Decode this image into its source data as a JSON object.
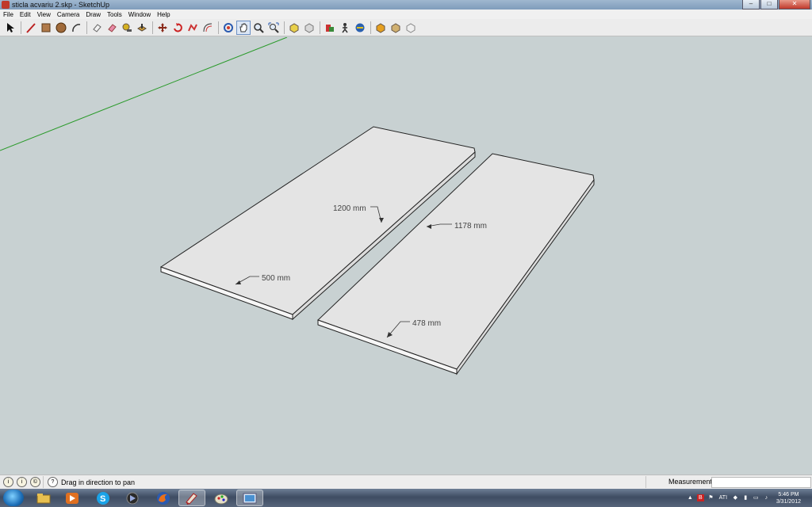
{
  "window": {
    "title": "sticla acvariu 2.skp - SketchUp",
    "buttons": [
      "–",
      "□",
      "✕"
    ]
  },
  "menu": [
    "File",
    "Edit",
    "View",
    "Camera",
    "Draw",
    "Tools",
    "Window",
    "Help"
  ],
  "toolbar": {
    "tools": [
      "select-icon",
      "line-icon",
      "rectangle-icon",
      "circle-icon",
      "arc-icon",
      "eraser-icon",
      "paint-bucket-icon",
      "tape-measure-icon",
      "push-pull-icon",
      "move-icon",
      "rotate-icon",
      "follow-me-icon",
      "offset-icon",
      "orbit-icon",
      "pan-icon",
      "zoom-icon",
      "zoom-extents-icon",
      "component-icon",
      "warehouse-icon",
      "section-plane-icon",
      "walk-icon",
      "position-camera-icon",
      "shadow-icon",
      "styles-icon",
      "get-models-icon"
    ]
  },
  "scene": {
    "dimensions": [
      "1200 mm",
      "500 mm",
      "1178 mm",
      "478 mm"
    ],
    "colors": {
      "background": "#c8d1d2",
      "panel_top": "#e4e4e4",
      "panel_edge": "#f4f4f4",
      "axis_green": "#2a9a2a"
    }
  },
  "statusbar": {
    "hint": "Drag in direction to pan",
    "measurements_label": "Measurements",
    "measurements_value": ""
  },
  "taskbar": {
    "apps": [
      "explorer-icon",
      "media-player-icon",
      "skype-icon",
      "winamp-icon",
      "firefox-icon",
      "sketchup-icon",
      "paint-icon",
      "image-viewer-icon"
    ],
    "active": [
      "sketchup-icon"
    ],
    "clock_time": "5:46 PM",
    "clock_date": "3/31/2012"
  }
}
